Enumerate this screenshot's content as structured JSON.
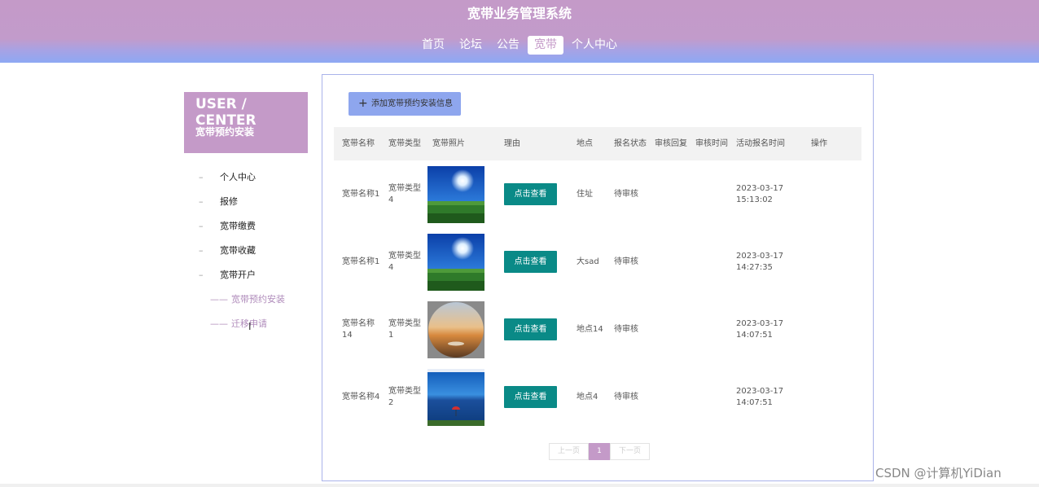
{
  "site": {
    "title": "宽带业务管理系统"
  },
  "nav": [
    {
      "label": "首页",
      "active": false
    },
    {
      "label": "论坛",
      "active": false
    },
    {
      "label": "公告",
      "active": false
    },
    {
      "label": "宽带",
      "active": true
    },
    {
      "label": "个人中心",
      "active": false
    }
  ],
  "sidebar": {
    "title_en": "USER / CENTER",
    "title_cn": "宽带预约安装",
    "items": [
      "个人中心",
      "报修",
      "宽带缴费",
      "宽带收藏",
      "宽带开户"
    ],
    "sub_items": [
      "宽带预约安装",
      "迁移申请"
    ]
  },
  "toolbar": {
    "add_label": "添加宽带预约安装信息"
  },
  "table": {
    "headers": [
      "宽带名称",
      "宽带类型",
      "宽带照片",
      "理由",
      "地点",
      "报名状态",
      "审核回复",
      "审核时间",
      "活动报名时间",
      "操作"
    ],
    "view_label": "点击查看",
    "rows": [
      {
        "name": "宽带名称1",
        "type": "宽带类型4",
        "place": "住址",
        "status": "待审核",
        "reply": "",
        "audit_time": "",
        "time": "2023-03-17 15:13:02"
      },
      {
        "name": "宽带名称1",
        "type": "宽带类型4",
        "place": "大sad",
        "status": "待审核",
        "reply": "",
        "audit_time": "",
        "time": "2023-03-17 14:27:35"
      },
      {
        "name": "宽带名称14",
        "type": "宽带类型1",
        "place": "地点14",
        "status": "待审核",
        "reply": "",
        "audit_time": "",
        "time": "2023-03-17 14:07:51"
      },
      {
        "name": "宽带名称4",
        "type": "宽带类型2",
        "place": "地点4",
        "status": "待审核",
        "reply": "",
        "audit_time": "",
        "time": "2023-03-17 14:07:51"
      }
    ]
  },
  "pagination": {
    "prev": "上一页",
    "current": "1",
    "next": "下一页"
  },
  "watermark": "CSDN @计算机YiDian",
  "colors": {
    "brand": "#c49ac8",
    "nav_gradient_end": "#8ea8f3",
    "view_button": "#0a8a87",
    "add_button": "#8ea6ee"
  }
}
